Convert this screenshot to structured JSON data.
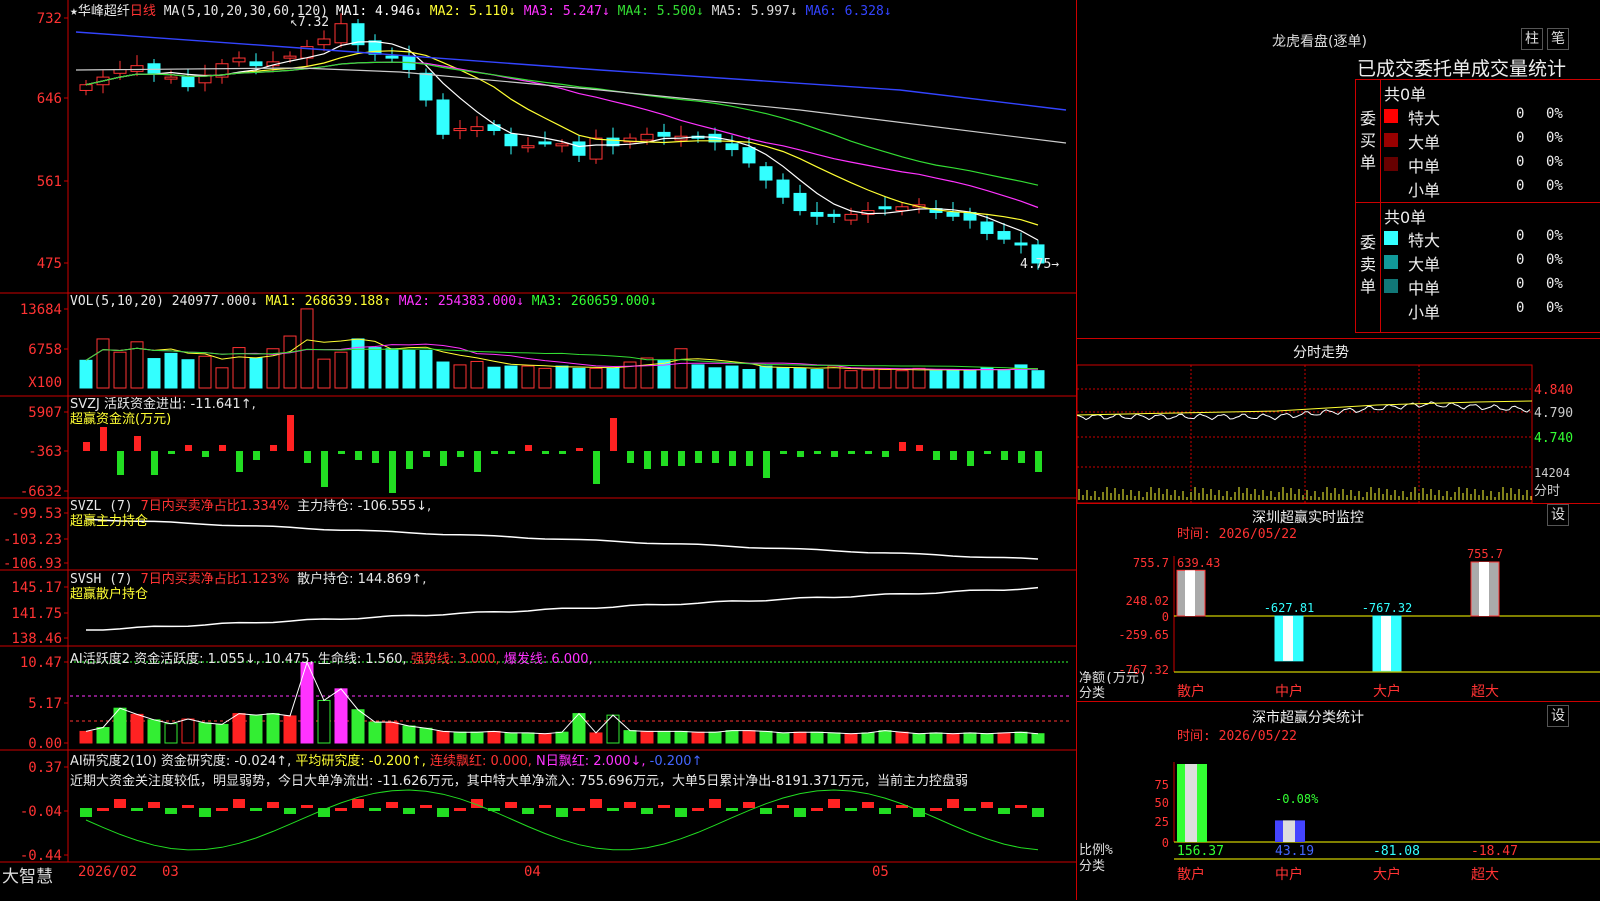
{
  "stock": {
    "star": "★",
    "name": "华峰超纤",
    "period": "日线"
  },
  "main": {
    "ma_label": "MA(5,10,20,30,60,120)",
    "ma": [
      {
        "label": "MA1: 4.946↓",
        "color": "#ffffff"
      },
      {
        "label": "MA2: 5.110↓",
        "color": "#ffff33"
      },
      {
        "label": "MA3: 5.247↓",
        "color": "#ff33ff"
      },
      {
        "label": "MA4: 5.500↓",
        "color": "#33dd33"
      },
      {
        "label": "MA5: 5.997↓",
        "color": "#dddddd"
      },
      {
        "label": "MA6: 6.328↓",
        "color": "#3344ff"
      }
    ],
    "y_ticks": [
      "732",
      "646",
      "561",
      "475"
    ],
    "high_marker": "7.32",
    "last_price_marker": "4.75"
  },
  "vol": {
    "header_name": "VOL(5,10,20)",
    "value": "240977.000↓",
    "ma1": "MA1: 268639.188↑",
    "ma2": "MA2: 254383.000↓",
    "ma3": "MA3: 260659.000↓",
    "y_ticks": [
      "13684",
      "6758",
      "X100"
    ]
  },
  "svzj": {
    "header": "SVZJ  活跃资金进出: -11.641↑,",
    "sub": "超赢资金流(万元)",
    "y_ticks": [
      "5907",
      "-363",
      "-6632"
    ]
  },
  "svzl": {
    "name": "SVZL (7)",
    "ratio": "7日内买卖净占比1.334%",
    "hold": "主力持仓: -106.555↓,",
    "sub": "超赢主力持仓",
    "y_ticks": [
      "-99.53",
      "-103.23",
      "-106.93"
    ]
  },
  "svsh": {
    "name": "SVSH (7)",
    "ratio": "7日内买卖净占比1.123%",
    "hold": "散户持仓: 144.869↑,",
    "sub": "超赢散户持仓",
    "y_ticks": [
      "145.17",
      "141.75",
      "138.46"
    ]
  },
  "ai_act": {
    "name": "AI活跃度2",
    "act": "资金活跃度: 1.055↓,",
    "v2": "10.475,",
    "life": "生命线: 1.560,",
    "strong": "强势线: 3.000,",
    "burst": "爆发线: 6.000,",
    "y_ticks": [
      "10.47",
      "5.17",
      "0.00"
    ]
  },
  "ai_research": {
    "name": "AI研究度2(10)",
    "research": "资金研究度: -0.024↑,",
    "avg": "平均研究度: -0.200↑,",
    "red_cont": "连续飘红: 0.000,",
    "n_red": "N日飘红: 2.000↓,",
    "last": "-0.200↑",
    "comment": "近期大资金关注度较低，明显弱势，今日大单净流出: -11.626万元，其中特大单净流入: 755.696万元，大单5日累计净出-8191.371万元，当前主力控盘弱",
    "y_ticks": [
      "0.37",
      "-0.04",
      "-0.44"
    ]
  },
  "bottom_bar": {
    "brand": "大智慧",
    "dates": [
      "2026/02",
      "03",
      "04",
      "05"
    ]
  },
  "dragon": {
    "title": "龙虎看盘(逐单)",
    "btn1": "柱",
    "btn2": "笔",
    "banner": "已成交委托单成交量统计",
    "buy_group": "委买单",
    "sell_group": "委卖单",
    "buy_total": "共0单",
    "sell_total": "共0单",
    "buy_rows": [
      {
        "label": "特大",
        "count": "0",
        "pct": "0%",
        "color": "#ff0000"
      },
      {
        "label": "大单",
        "count": "0",
        "pct": "0%",
        "color": "#990000"
      },
      {
        "label": "中单",
        "count": "0",
        "pct": "0%",
        "color": "#660000"
      },
      {
        "label": "小单",
        "count": "0",
        "pct": "0%",
        "color": ""
      }
    ],
    "sell_rows": [
      {
        "label": "特大",
        "count": "0",
        "pct": "0%",
        "color": "#33ffff"
      },
      {
        "label": "大单",
        "count": "0",
        "pct": "0%",
        "color": "#119999"
      },
      {
        "label": "中单",
        "count": "0",
        "pct": "0%",
        "color": "#117777"
      },
      {
        "label": "小单",
        "count": "0",
        "pct": "0%",
        "color": ""
      }
    ]
  },
  "intraday": {
    "title": "分时走势",
    "y_ticks": [
      "4.840",
      "4.790",
      "4.740"
    ],
    "vol_tick": "14204",
    "vol_label": "分时"
  },
  "sz_monitor": {
    "title": "深圳超赢实时监控",
    "settings": "设",
    "time": "时间: 2026/05/22",
    "y_ticks": [
      "755.7",
      "248.02",
      "0",
      "-259.65",
      "-767.32"
    ],
    "top_value": "639.43",
    "axis_label1": "净额(万元)",
    "axis_label2": "分类",
    "categories": [
      "散户",
      "中户",
      "大户",
      "超大"
    ],
    "values": [
      639.43,
      -627.81,
      -767.32,
      755.7
    ],
    "value_labels": [
      "639.43",
      "-627.81",
      "-767.32",
      "755.7"
    ]
  },
  "sz_class": {
    "title": "深市超赢分类统计",
    "settings": "设",
    "time": "时间: 2026/05/22",
    "y_ticks": [
      "75",
      "50",
      "25",
      "0"
    ],
    "axis_label1": "比例%",
    "axis_label2": "分类",
    "categories": [
      "散户",
      "中户",
      "大户",
      "超大"
    ],
    "values": [
      156.37,
      43.19,
      -81.08,
      -18.47
    ],
    "value_labels": [
      "156.37",
      "43.19",
      "-81.08",
      "-18.47"
    ],
    "top_label": "-0.08%"
  },
  "chart_data": {
    "type": "candlestick",
    "note": "Daily K-line of 华峰超纤 with indicator panels; approximate readings.",
    "close": [
      6.62,
      6.7,
      6.78,
      6.82,
      6.74,
      6.7,
      6.6,
      6.72,
      6.84,
      6.9,
      6.82,
      6.86,
      6.92,
      7.02,
      7.1,
      7.26,
      7.04,
      6.94,
      6.9,
      6.78,
      6.46,
      6.1,
      6.16,
      6.18,
      6.14,
      5.98,
      5.98,
      6.02,
      6.0,
      5.88,
      6.06,
      5.98,
      6.06,
      6.1,
      6.08,
      6.08,
      6.06,
      6.02,
      5.94,
      5.8,
      5.62,
      5.44,
      5.3,
      5.24,
      5.24,
      5.26,
      5.3,
      5.32,
      5.34,
      5.36,
      5.28,
      5.24,
      5.2,
      5.06,
      5.0,
      4.94,
      4.75
    ],
    "volume_x100": [
      4.8,
      8.5,
      6.2,
      8.0,
      5.1,
      6.0,
      4.9,
      5.5,
      3.5,
      7.0,
      5.2,
      6.8,
      9.0,
      13.7,
      5.0,
      6.2,
      8.5,
      7.0,
      6.8,
      6.5,
      6.5,
      4.5,
      4.0,
      4.6,
      3.6,
      3.8,
      3.8,
      3.4,
      3.8,
      3.4,
      3.4,
      3.5,
      4.5,
      5.2,
      4.8,
      6.8,
      4.0,
      3.5,
      3.8,
      3.2,
      3.8,
      3.5,
      3.4,
      3.2,
      3.8,
      3.0,
      3.1,
      3.2,
      3.0,
      3.4,
      3.0,
      3.1,
      3.0,
      3.5,
      3.2,
      4.0,
      3.0
    ]
  }
}
